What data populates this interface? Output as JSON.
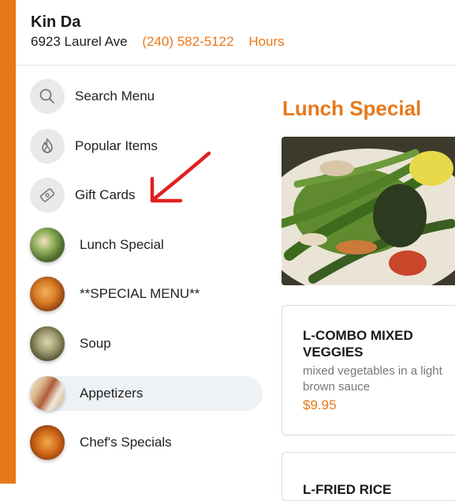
{
  "restaurant": {
    "name": "Kin Da",
    "address": "6923 Laurel Ave",
    "phone": "(240) 582-5122",
    "hours_label": "Hours"
  },
  "colors": {
    "accent": "#e8781a",
    "annotation_arrow": "#e02020"
  },
  "nav": {
    "active_index": 7,
    "items": [
      {
        "label": "Search Menu",
        "icon": "search-icon"
      },
      {
        "label": "Popular Items",
        "icon": "flame-icon"
      },
      {
        "label": "Gift Cards",
        "icon": "gift-card-icon"
      },
      {
        "label": "Lunch Special",
        "icon": "lunch-special-thumbnail"
      },
      {
        "label": "**SPECIAL MENU**",
        "icon": "special-menu-thumbnail"
      },
      {
        "label": "Soup",
        "icon": "soup-thumbnail"
      },
      {
        "label": "Appetizers",
        "icon": "appetizers-thumbnail"
      },
      {
        "label": "Chef's Specials",
        "icon": "chefs-specials-thumbnail"
      }
    ]
  },
  "main": {
    "section_title": "Lunch Special",
    "items": [
      {
        "name": "L-COMBO MIXED VEGGIES",
        "description": "mixed vegetables in a light brown sauce",
        "price": "$9.95"
      },
      {
        "name": "L-FRIED RICE"
      }
    ]
  }
}
